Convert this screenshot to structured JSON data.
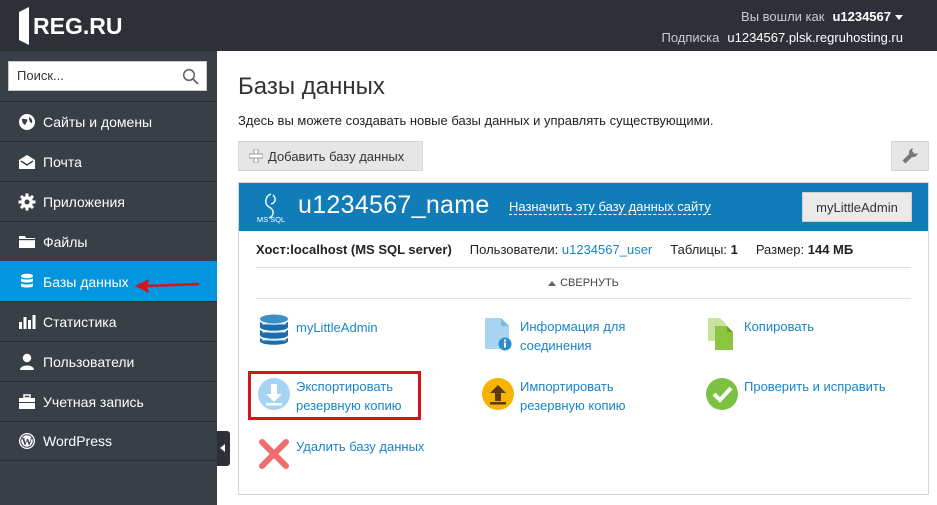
{
  "header": {
    "logo_text": "REG.RU",
    "logged_in_label": "Вы вошли как",
    "username": "u1234567",
    "subscription_label": "Подписка",
    "subscription_value": "u1234567.plsk.regruhosting.ru"
  },
  "sidebar": {
    "search_placeholder": "Поиск...",
    "items": [
      {
        "label": "Сайты и домены",
        "icon": "globe-icon"
      },
      {
        "label": "Почта",
        "icon": "envelope-icon"
      },
      {
        "label": "Приложения",
        "icon": "gear-icon"
      },
      {
        "label": "Файлы",
        "icon": "folder-icon"
      },
      {
        "label": "Базы данных",
        "icon": "database-icon",
        "active": true
      },
      {
        "label": "Статистика",
        "icon": "bar-chart-icon"
      },
      {
        "label": "Пользователи",
        "icon": "user-icon"
      },
      {
        "label": "Учетная запись",
        "icon": "briefcase-icon"
      },
      {
        "label": "WordPress",
        "icon": "wordpress-icon"
      }
    ]
  },
  "main": {
    "title": "Базы данных",
    "description": "Здесь вы можете создавать новые базы данных и управлять существующими.",
    "add_button": "Добавить базу данных"
  },
  "database": {
    "badge": "MS SQL",
    "name": "u1234567_name",
    "assign_link": "Назначить эту базу данных сайту",
    "admin_button": "myLittleAdmin",
    "host_label": "Хост:",
    "host_value": "localhost (MS SQL server)",
    "users_label": "Пользователи:",
    "users_value": "u1234567_user",
    "tables_label": "Таблицы:",
    "tables_value": "1",
    "size_label": "Размер:",
    "size_value": "144 МБ",
    "collapse_label": "СВЕРНУТЬ",
    "actions": {
      "mla": "myLittleAdmin",
      "conn_info_1": "Информация для",
      "conn_info_2": "соединения",
      "copy": "Копировать",
      "export_1": "Экспортировать",
      "export_2": "резервную копию",
      "import_1": "Импортировать",
      "import_2": "резервную копию",
      "check": "Проверить и исправить",
      "delete": "Удалить базу данных"
    }
  },
  "colors": {
    "topbar": "#2d3137",
    "sidebar": "#393f47",
    "active": "#0396de",
    "db_header": "#117db8",
    "link": "#1a85c7",
    "highlight": "#d5131d"
  }
}
